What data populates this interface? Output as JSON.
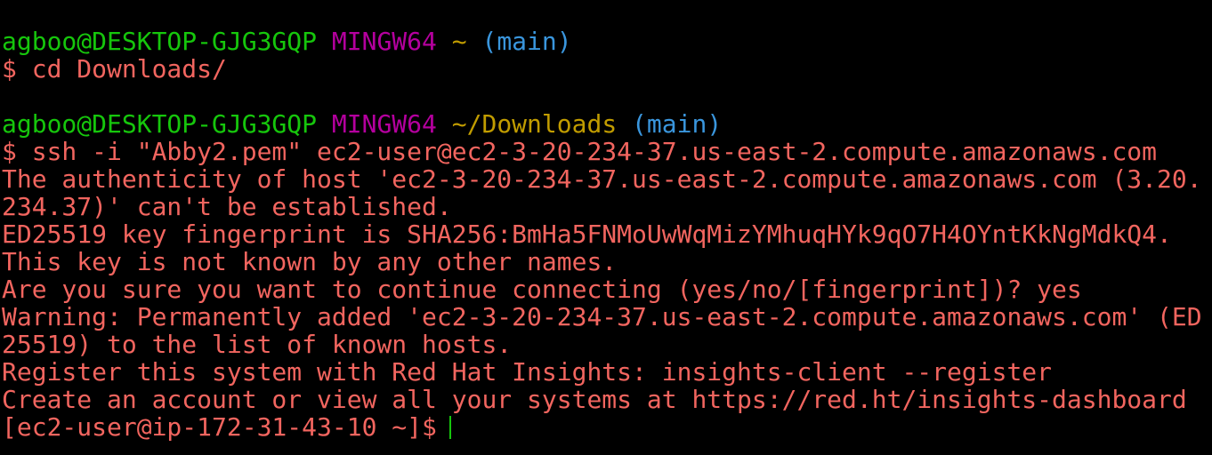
{
  "terminal": {
    "prompt1": {
      "user_host": "agboo@DESKTOP-GJG3GQP",
      "shell": "MINGW64",
      "path": "~",
      "branch": "(main)"
    },
    "cmd1": "$ cd Downloads/",
    "prompt2": {
      "user_host": "agboo@DESKTOP-GJG3GQP",
      "shell": "MINGW64",
      "path": "~/Downloads",
      "branch": "(main)"
    },
    "cmd2": "$ ssh -i \"Abby2.pem\" ec2-user@ec2-3-20-234-37.us-east-2.compute.amazonaws.com",
    "output": [
      "The authenticity of host 'ec2-3-20-234-37.us-east-2.compute.amazonaws.com (3.20.",
      "234.37)' can't be established.",
      "ED25519 key fingerprint is SHA256:BmHa5FNMoUwWqMizYMhuqHYk9qO7H4OYntKkNgMdkQ4.",
      "This key is not known by any other names.",
      "Are you sure you want to continue connecting (yes/no/[fingerprint])? yes",
      "Warning: Permanently added 'ec2-3-20-234-37.us-east-2.compute.amazonaws.com' (ED",
      "25519) to the list of known hosts.",
      "Register this system with Red Hat Insights: insights-client --register",
      "Create an account or view all your systems at https://red.ht/insights-dashboard"
    ],
    "remote_prompt": "[ec2-user@ip-172-31-43-10 ~]$"
  },
  "colors": {
    "background": "#000000",
    "user_host": "#16c60c",
    "shell": "#b4009e",
    "path": "#c19c00",
    "branch": "#3a96dd",
    "text": "#f2655f",
    "cursor": "#16c60c"
  }
}
